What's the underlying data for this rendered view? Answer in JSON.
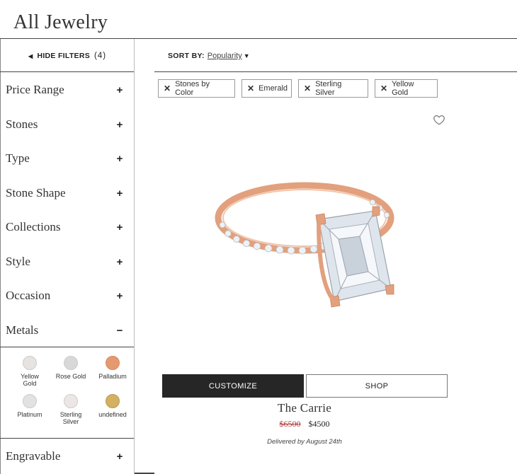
{
  "page": {
    "title": "All Jewelry"
  },
  "filters_toggle": {
    "label": "HIDE FILTERS",
    "count": "(4)"
  },
  "sort": {
    "label": "SORT BY:",
    "value": "Popularity"
  },
  "filters": [
    {
      "label": "Price Range",
      "sign": "+"
    },
    {
      "label": "Stones",
      "sign": "+"
    },
    {
      "label": "Type",
      "sign": "+"
    },
    {
      "label": "Stone Shape",
      "sign": "+"
    },
    {
      "label": "Collections",
      "sign": "+"
    },
    {
      "label": "Style",
      "sign": "+"
    },
    {
      "label": "Occasion",
      "sign": "+"
    },
    {
      "label": "Metals",
      "sign": "−"
    },
    {
      "label": "Engravable",
      "sign": "+"
    }
  ],
  "metals": [
    {
      "name": "Yellow Gold",
      "color": "#e6e3e1"
    },
    {
      "name": "Rose Gold",
      "color": "#d8d8d8"
    },
    {
      "name": "Palladium",
      "color": "#e49a6e"
    },
    {
      "name": "Platinum",
      "color": "#e2e2e2"
    },
    {
      "name": "Sterling Silver",
      "color": "#ece7e4"
    },
    {
      "name": "undefined",
      "color": "#d3b063"
    }
  ],
  "active_filters": [
    {
      "label": "Stones by Color"
    },
    {
      "label": "Emerald"
    },
    {
      "label": "Sterling Silver"
    },
    {
      "label": "Yellow Gold"
    }
  ],
  "product": {
    "customize_label": "CUSTOMIZE",
    "shop_label": "SHOP",
    "name": "The Carrie",
    "old_price": "$6500",
    "new_price": "$4500",
    "delivery": "Delivered by August 24th"
  },
  "colors": {
    "rose_gold_band": "#e2a07d",
    "dark_button": "#262626"
  }
}
